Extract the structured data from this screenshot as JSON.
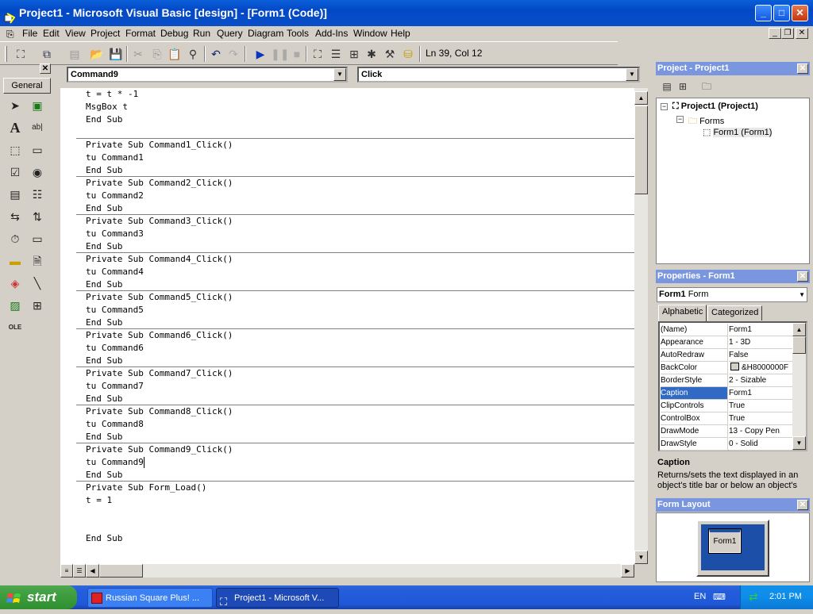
{
  "window": {
    "title": "Project1 - Microsoft Visual Basic [design] - [Form1 (Code)]"
  },
  "menu": [
    "File",
    "Edit",
    "View",
    "Project",
    "Format",
    "Debug",
    "Run",
    "Query",
    "Diagram",
    "Tools",
    "Add-Ins",
    "Window",
    "Help"
  ],
  "toolbar": {
    "position": "Ln 39, Col 12"
  },
  "toolbox": {
    "tab_label": "General"
  },
  "code": {
    "object_combo": "Command9",
    "procedure_combo": "Click",
    "lines": [
      "t = t * -1",
      "MsgBox t",
      "End Sub",
      "",
      "Private Sub Command1_Click()",
      "tu Command1",
      "End Sub",
      "Private Sub Command2_Click()",
      "tu Command2",
      "End Sub",
      "Private Sub Command3_Click()",
      "tu Command3",
      "End Sub",
      "Private Sub Command4_Click()",
      "tu Command4",
      "End Sub",
      "Private Sub Command5_Click()",
      "tu Command5",
      "End Sub",
      "Private Sub Command6_Click()",
      "tu Command6",
      "End Sub",
      "Private Sub Command7_Click()",
      "tu Command7",
      "End Sub",
      "Private Sub Command8_Click()",
      "tu Command8",
      "End Sub",
      "Private Sub Command9_Click()",
      "tu Command9",
      "End Sub",
      "Private Sub Form_Load()",
      "t = 1",
      "",
      "",
      "End Sub"
    ]
  },
  "project_pane": {
    "title": "Project - Project1",
    "root": "Project1 (Project1)",
    "folder": "Forms",
    "item": "Form1 (Form1)"
  },
  "properties_pane": {
    "title": "Properties - Form1",
    "object_name": "Form1",
    "object_type": "Form",
    "tabs": [
      "Alphabetic",
      "Categorized"
    ],
    "rows": [
      {
        "name": "(Name)",
        "value": "Form1"
      },
      {
        "name": "Appearance",
        "value": "1 - 3D"
      },
      {
        "name": "AutoRedraw",
        "value": "False"
      },
      {
        "name": "BackColor",
        "value": "&H8000000F"
      },
      {
        "name": "BorderStyle",
        "value": "2 - Sizable"
      },
      {
        "name": "Caption",
        "value": "Form1"
      },
      {
        "name": "ClipControls",
        "value": "True"
      },
      {
        "name": "ControlBox",
        "value": "True"
      },
      {
        "name": "DrawMode",
        "value": "13 - Copy Pen"
      },
      {
        "name": "DrawStyle",
        "value": "0 - Solid"
      }
    ],
    "selected_index": 5,
    "description_title": "Caption",
    "description_text": "Returns/sets the text displayed in an object's title bar or below an object's"
  },
  "form_layout_pane": {
    "title": "Form Layout",
    "form_label": "Form1"
  },
  "taskbar": {
    "start": "start",
    "tasks": [
      "Russian Square Plus! ...",
      "Project1 - Microsoft V..."
    ],
    "lang": "EN",
    "clock": "2:01 PM"
  },
  "colors": {
    "titlebar": "#0a5fd8",
    "pane_title": "#7a96df",
    "selection": "#316ac5",
    "taskbar": "#245edc",
    "start": "#3c9b3c",
    "layout_screen": "#1c4fa8"
  }
}
